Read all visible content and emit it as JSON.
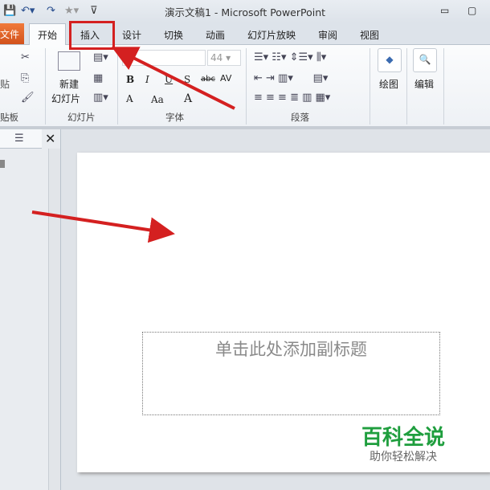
{
  "window": {
    "title": "演示文稿1 - Microsoft PowerPoint",
    "minimize": "▭",
    "maximize": "▢"
  },
  "tabs": [
    "文件",
    "开始",
    "插入",
    "设计",
    "切换",
    "动画",
    "幻灯片放映",
    "审阅",
    "视图"
  ],
  "ribbon": {
    "clipboard": {
      "paste": "贴",
      "group": "贴板"
    },
    "slides": {
      "new_slide_1": "新建",
      "new_slide_2": "幻灯片",
      "group": "幻灯片"
    },
    "font": {
      "size": "44",
      "group": "字体",
      "bold": "B",
      "italic": "I",
      "underline": "U",
      "strike": "S",
      "abc": "abc",
      "spacing": "AV",
      "color": "A",
      "case": "Aa",
      "grow": "A"
    },
    "paragraph": {
      "group": "段落"
    },
    "drawing": {
      "label": "绘图"
    },
    "editing": {
      "label": "编辑"
    }
  },
  "slide": {
    "subtitle_placeholder": "单击此处添加副标题"
  },
  "watermark": {
    "title": "百科全说",
    "subtitle": "助你轻松解决"
  },
  "annotation_color": "#d42020"
}
